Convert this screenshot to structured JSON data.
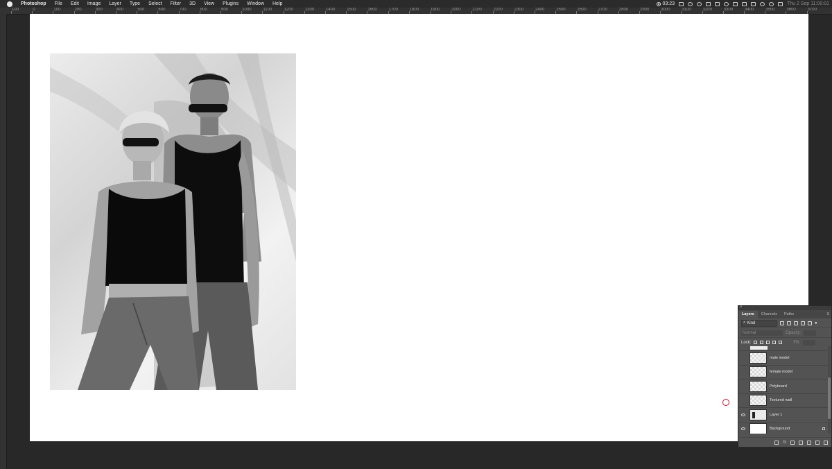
{
  "menubar": {
    "app_name": "Photoshop",
    "items": [
      "File",
      "Edit",
      "Image",
      "Layer",
      "Type",
      "Select",
      "Filter",
      "3D",
      "View",
      "Plugins",
      "Window",
      "Help"
    ],
    "recording_time": "03:23",
    "clock": "Thu 2 Sep  11:00:01"
  },
  "ruler": {
    "top_labels": [
      "100",
      "0",
      "100",
      "200",
      "300",
      "400",
      "500",
      "600",
      "700",
      "800",
      "900",
      "1000",
      "1100",
      "1200",
      "1300",
      "1400",
      "1500",
      "1600",
      "1700",
      "1800",
      "1900",
      "2000",
      "2100",
      "2200",
      "2300",
      "2400",
      "2500",
      "2600",
      "2700",
      "2800",
      "2900",
      "3000",
      "3100",
      "3200",
      "3300",
      "3400",
      "3500",
      "3600",
      "3700"
    ]
  },
  "layers_panel": {
    "tabs": [
      "Layers",
      "Channels",
      "Paths"
    ],
    "active_tab": "Layers",
    "kind_label": "Kind",
    "blend_mode": "Normal",
    "opacity_label": "Opacity:",
    "lock_label": "Lock:",
    "fill_label": "Fill:",
    "layers": [
      {
        "name": "male model",
        "visible": false,
        "thumb": "transparent"
      },
      {
        "name": "female model",
        "visible": false,
        "thumb": "transparent"
      },
      {
        "name": "Polyboard",
        "visible": false,
        "thumb": "transparent"
      },
      {
        "name": "Textured wall",
        "visible": false,
        "thumb": "transparent"
      },
      {
        "name": "Layer 1",
        "visible": true,
        "thumb": "photo"
      },
      {
        "name": "Background",
        "visible": true,
        "thumb": "white",
        "locked": true
      }
    ]
  },
  "colors": {
    "workspace": "#282828",
    "canvas": "#ffffff",
    "panel": "#535353",
    "cursor_ring": "#c0142c"
  }
}
